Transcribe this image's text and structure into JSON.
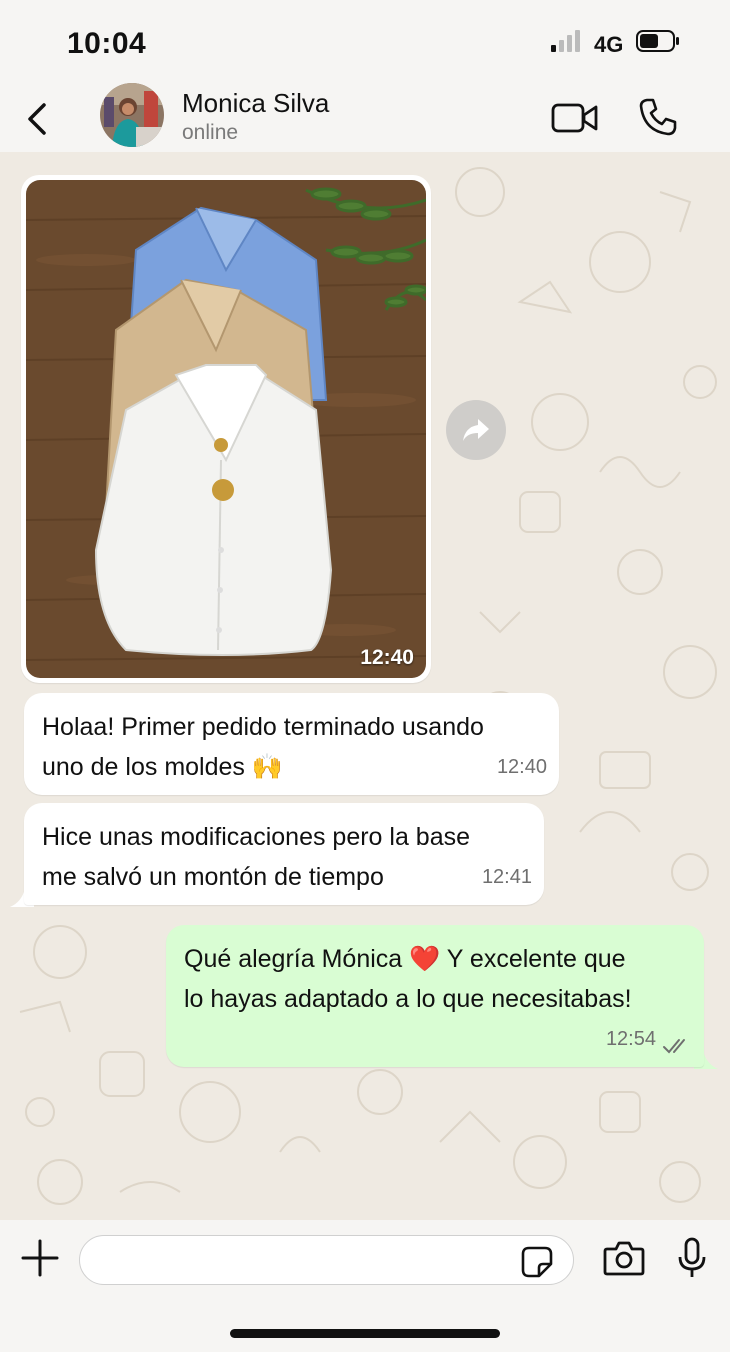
{
  "status_bar": {
    "time": "10:04",
    "network": "4G"
  },
  "header": {
    "contact_name": "Monica Silva",
    "contact_status": "online"
  },
  "messages": [
    {
      "type": "image",
      "direction": "incoming",
      "time": "12:40"
    },
    {
      "type": "text",
      "direction": "incoming",
      "text": "Holaa! Primer pedido terminado usando\nuno de los moldes 🙌",
      "time": "12:40"
    },
    {
      "type": "text",
      "direction": "incoming",
      "text": "Hice unas modificaciones pero la base\nme salvó un montón de tiempo",
      "time": "12:41"
    },
    {
      "type": "text",
      "direction": "outgoing",
      "text": "Qué alegría Mónica ❤️ Y excelente que\nlo hayas adaptado a lo que necesitabas!",
      "time": "12:54",
      "status_icon": "double-check-icon"
    }
  ],
  "input": {
    "placeholder": ""
  },
  "colors": {
    "outgoing_bubble": "#d9fdd3",
    "incoming_bubble": "#ffffff",
    "chat_background": "#efeae2"
  }
}
